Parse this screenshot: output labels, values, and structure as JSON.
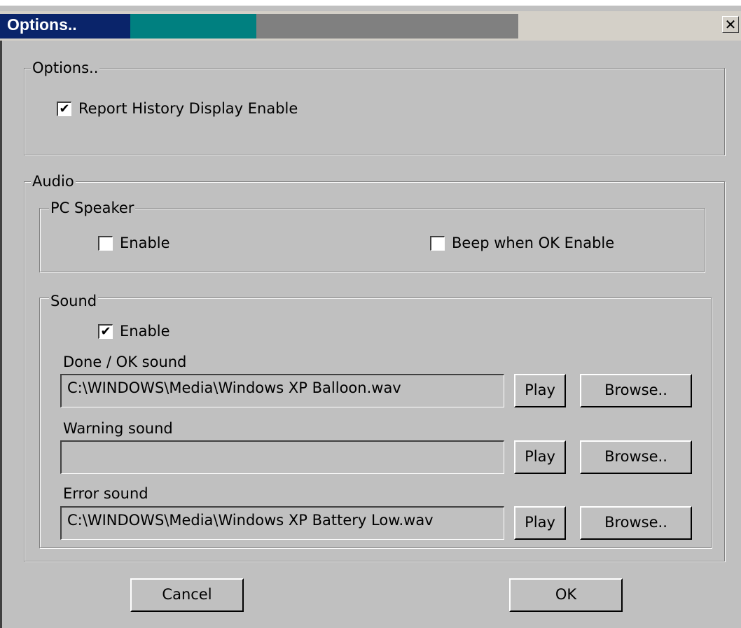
{
  "window": {
    "title": "Options..",
    "close_glyph": "✕"
  },
  "options_group": {
    "legend": "Options..",
    "report_history": {
      "label": "Report History Display Enable",
      "checked": true
    }
  },
  "audio_group": {
    "legend": "Audio",
    "pc_speaker": {
      "legend": "PC Speaker",
      "enable": {
        "label": "Enable",
        "checked": false
      },
      "beep_ok": {
        "label": "Beep when OK Enable",
        "checked": false
      }
    },
    "sound": {
      "legend": "Sound",
      "enable": {
        "label": "Enable",
        "checked": true
      },
      "done": {
        "label": "Done / OK sound",
        "value": "C:\\WINDOWS\\Media\\Windows XP Balloon.wav",
        "play": "Play",
        "browse": "Browse.."
      },
      "warning": {
        "label": "Warning sound",
        "value": "",
        "play": "Play",
        "browse": "Browse.."
      },
      "error": {
        "label": "Error sound",
        "value": "C:\\WINDOWS\\Media\\Windows XP Battery Low.wav",
        "play": "Play",
        "browse": "Browse.."
      }
    }
  },
  "buttons": {
    "cancel": "Cancel",
    "ok": "OK"
  },
  "checkmark_glyph": "✔"
}
